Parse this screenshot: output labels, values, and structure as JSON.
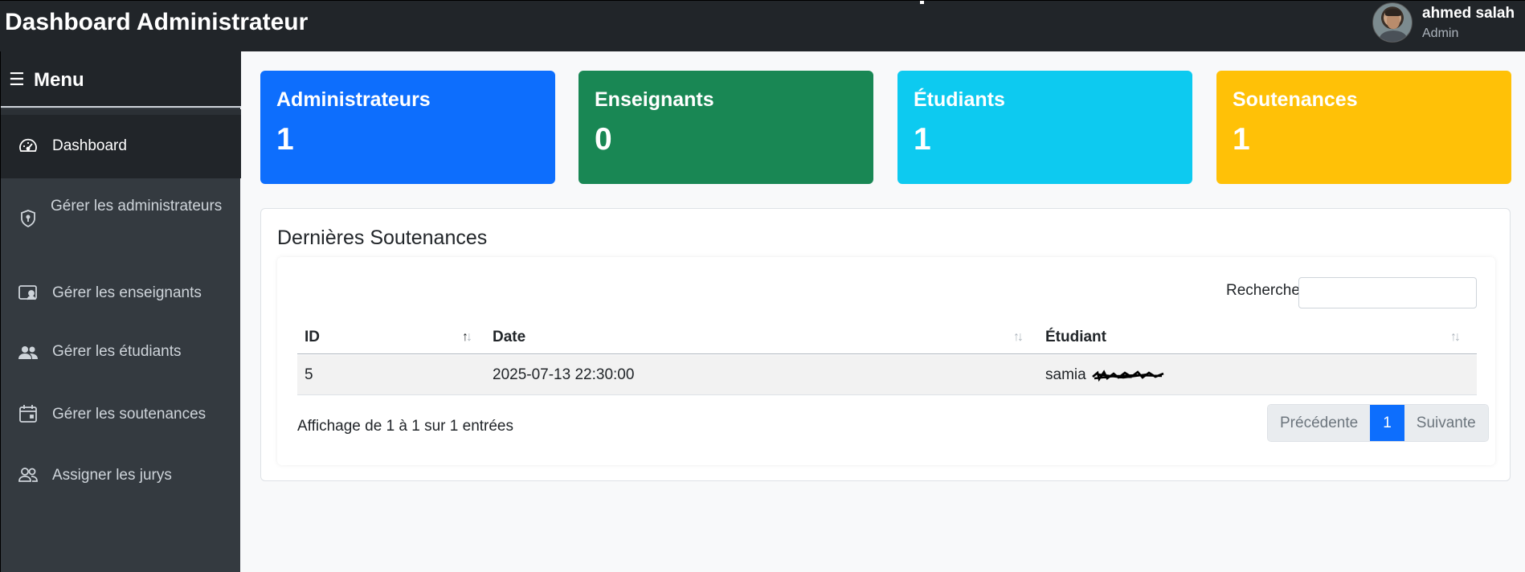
{
  "header": {
    "title": "Dashboard Administrateur"
  },
  "user": {
    "name": "ahmed salah",
    "role": "Admin"
  },
  "sidebar": {
    "title": "Menu",
    "items": [
      {
        "label": "Dashboard",
        "icon": "speedometer-icon",
        "active": true
      },
      {
        "label": "Gérer les administrateurs",
        "icon": "shield-icon"
      },
      {
        "label": "Gérer les enseignants",
        "icon": "person-video-icon"
      },
      {
        "label": "Gérer les étudiants",
        "icon": "people-icon"
      },
      {
        "label": "Gérer les soutenances",
        "icon": "calendar-icon"
      },
      {
        "label": "Assigner les jurys",
        "icon": "people-outline-icon"
      }
    ]
  },
  "stats": [
    {
      "label": "Administrateurs",
      "value": "1",
      "color": "#0d6efd"
    },
    {
      "label": "Enseignants",
      "value": "0",
      "color": "#198754"
    },
    {
      "label": "Étudiants",
      "value": "1",
      "color": "#0dcaf0"
    },
    {
      "label": "Soutenances",
      "value": "1",
      "color": "#ffc107"
    }
  ],
  "panel": {
    "title": "Dernières Soutenances",
    "search_label": "Rechercher:",
    "search_value": "",
    "columns": [
      "ID",
      "Date",
      "Étudiant"
    ],
    "rows": [
      {
        "id": "5",
        "date": "2025-07-13 22:30:00",
        "student": "samia"
      }
    ],
    "info": "Affichage de 1 à 1 sur 1 entrées",
    "pagination": {
      "prev": "Précédente",
      "current": "1",
      "next": "Suivante"
    }
  }
}
